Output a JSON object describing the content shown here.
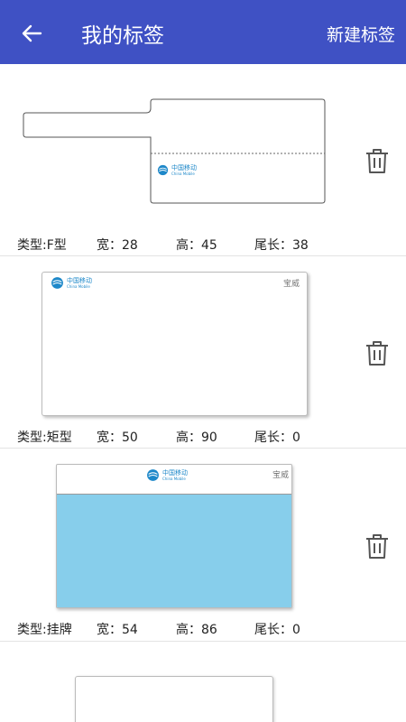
{
  "header": {
    "title": "我的标签",
    "new_label": "新建标签"
  },
  "brand_logo": {
    "cn": "中国移动",
    "en": "China Mobile"
  },
  "labels": [
    {
      "type": "类型:F型",
      "width": "宽：28",
      "height": "高：45",
      "tail": "尾长：38"
    },
    {
      "type": "类型:矩型",
      "width": "宽：50",
      "height": "高：90",
      "tail": "尾长：0",
      "brand": "宝威"
    },
    {
      "type": "类型:挂牌",
      "width": "宽：54",
      "height": "高：86",
      "tail": "尾长：0",
      "brand": "宝威"
    }
  ],
  "colors": {
    "appbar": "#3f51c4",
    "tag_fill": "#87ceeb",
    "logo": "#1e88c9"
  },
  "icons": {
    "back": "arrow-left-icon",
    "delete": "trash-icon"
  }
}
